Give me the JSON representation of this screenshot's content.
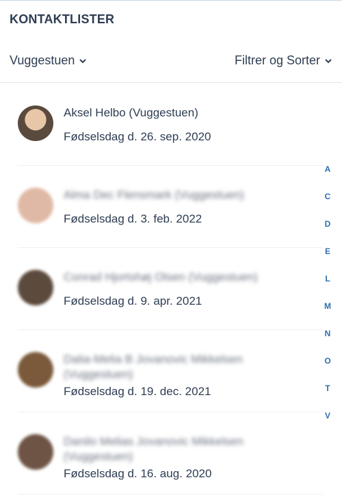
{
  "header": {
    "title": "KONTAKTLISTER"
  },
  "filters": {
    "group_label": "Vuggestuen",
    "sort_label": "Filtrer og Sorter"
  },
  "contacts": [
    {
      "name": "Aksel Helbo (Vuggestuen)",
      "birthday": "Fødselsdag d. 26. sep. 2020",
      "blurred": false,
      "avatar_color": "#8a6a52"
    },
    {
      "name": "Alma Dec Flensmark (Vuggestuen)",
      "birthday": "Fødselsdag d. 3. feb. 2022",
      "blurred": true,
      "avatar_color": "#e0b9a6"
    },
    {
      "name": "Conrad Hjortshøj Olsen (Vuggestuen)",
      "birthday": "Fødselsdag d. 9. apr. 2021",
      "blurred": true,
      "avatar_color": "#5c4a3c"
    },
    {
      "name": "Dalia-Melia B Jovanovic Mikkelsen (Vuggestuen)",
      "birthday": "Fødselsdag d. 19. dec. 2021",
      "blurred": true,
      "avatar_color": "#7a5a3a"
    },
    {
      "name": "Danilo Melias Jovanovic Mikkelsen (Vuggestuen)",
      "birthday": "Fødselsdag d. 16. aug. 2020",
      "blurred": true,
      "avatar_color": "#6e5444"
    }
  ],
  "alphabet_index": [
    "A",
    "C",
    "D",
    "E",
    "L",
    "M",
    "N",
    "O",
    "T",
    "V"
  ],
  "colors": {
    "accent": "#2f6fb0",
    "text": "#2e3d52"
  }
}
